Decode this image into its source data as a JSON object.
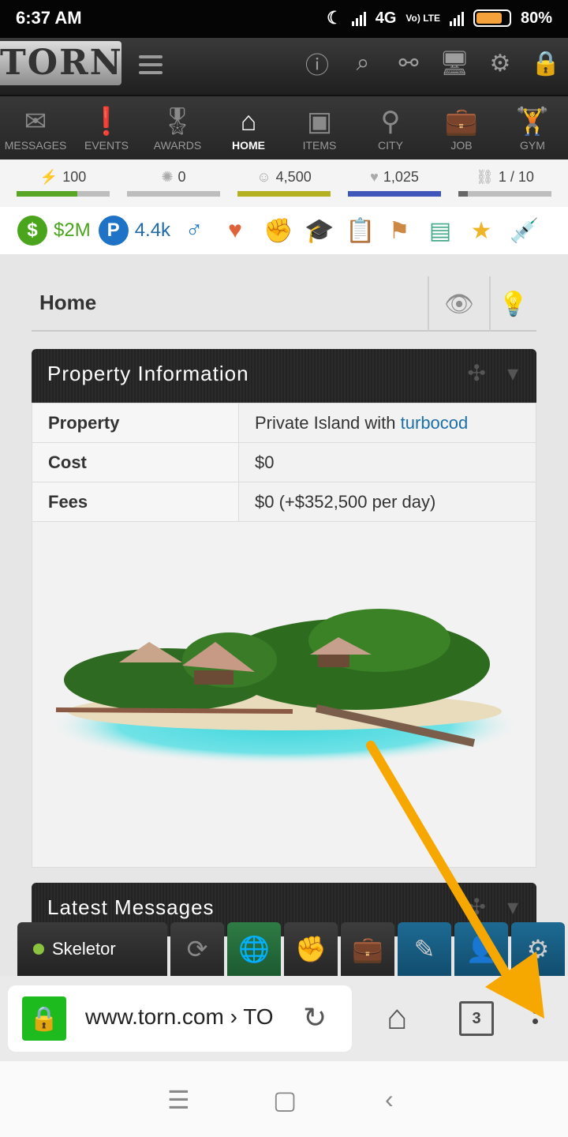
{
  "status": {
    "time": "6:37 AM",
    "network": "4G",
    "volte": "Vo) LTE",
    "battery": "80%"
  },
  "torn": {
    "logo": "TORN",
    "header_icons": [
      "info-icon",
      "search-icon",
      "binoculars-icon",
      "computer-icon",
      "gear-icon",
      "lock-icon"
    ],
    "nav": [
      {
        "label": "MESSAGES",
        "icon": "envelope-icon",
        "glyph": "✉"
      },
      {
        "label": "EVENTS",
        "icon": "exclamation-icon",
        "glyph": "❗"
      },
      {
        "label": "AWARDS",
        "icon": "medal-icon",
        "glyph": "🎖"
      },
      {
        "label": "HOME",
        "icon": "house-icon",
        "glyph": "⌂",
        "active": true
      },
      {
        "label": "ITEMS",
        "icon": "box-icon",
        "glyph": "▣"
      },
      {
        "label": "CITY",
        "icon": "map-pin-icon",
        "glyph": "⚲"
      },
      {
        "label": "JOB",
        "icon": "briefcase-icon",
        "glyph": "💼"
      },
      {
        "label": "GYM",
        "icon": "weightlifter-icon",
        "glyph": "🏋"
      }
    ],
    "bars": [
      {
        "name": "energy",
        "icon": "bolt-icon",
        "value": "100",
        "fraction": 0.65,
        "color": "#59a526"
      },
      {
        "name": "nerve",
        "icon": "nerve-icon",
        "value": "0",
        "fraction": 0.0,
        "color": "#bbbbbb"
      },
      {
        "name": "happy",
        "icon": "smiley-icon",
        "value": "4,500",
        "fraction": 1.0,
        "color": "#b3b122"
      },
      {
        "name": "life",
        "icon": "heart-icon",
        "value": "1,025",
        "fraction": 1.0,
        "color": "#3f56bb"
      },
      {
        "name": "chain",
        "icon": "chain-icon",
        "value": "1 / 10",
        "fraction": 0.1,
        "color": "#666666"
      }
    ],
    "money": "$2M",
    "points": "4.4k",
    "row_icons": [
      "male-icon",
      "heart-icon",
      "fist-icon",
      "graduation-cap-icon",
      "clipboard-icon",
      "faction-icon",
      "education-icon",
      "star-icon",
      "syringe-icon"
    ]
  },
  "home": {
    "title": "Home",
    "panel_title": "Property Information",
    "rows": [
      {
        "label": "Property",
        "value": "Private Island with ",
        "link": "turbocod"
      },
      {
        "label": "Cost",
        "value": "$0"
      },
      {
        "label": "Fees",
        "value": "$0 (+$352,500 per day)"
      }
    ],
    "panel2_title": "Latest Messages"
  },
  "chat": {
    "name": "Skeletor"
  },
  "browser": {
    "url": "www.torn.com › TO",
    "tab_count": "3"
  }
}
